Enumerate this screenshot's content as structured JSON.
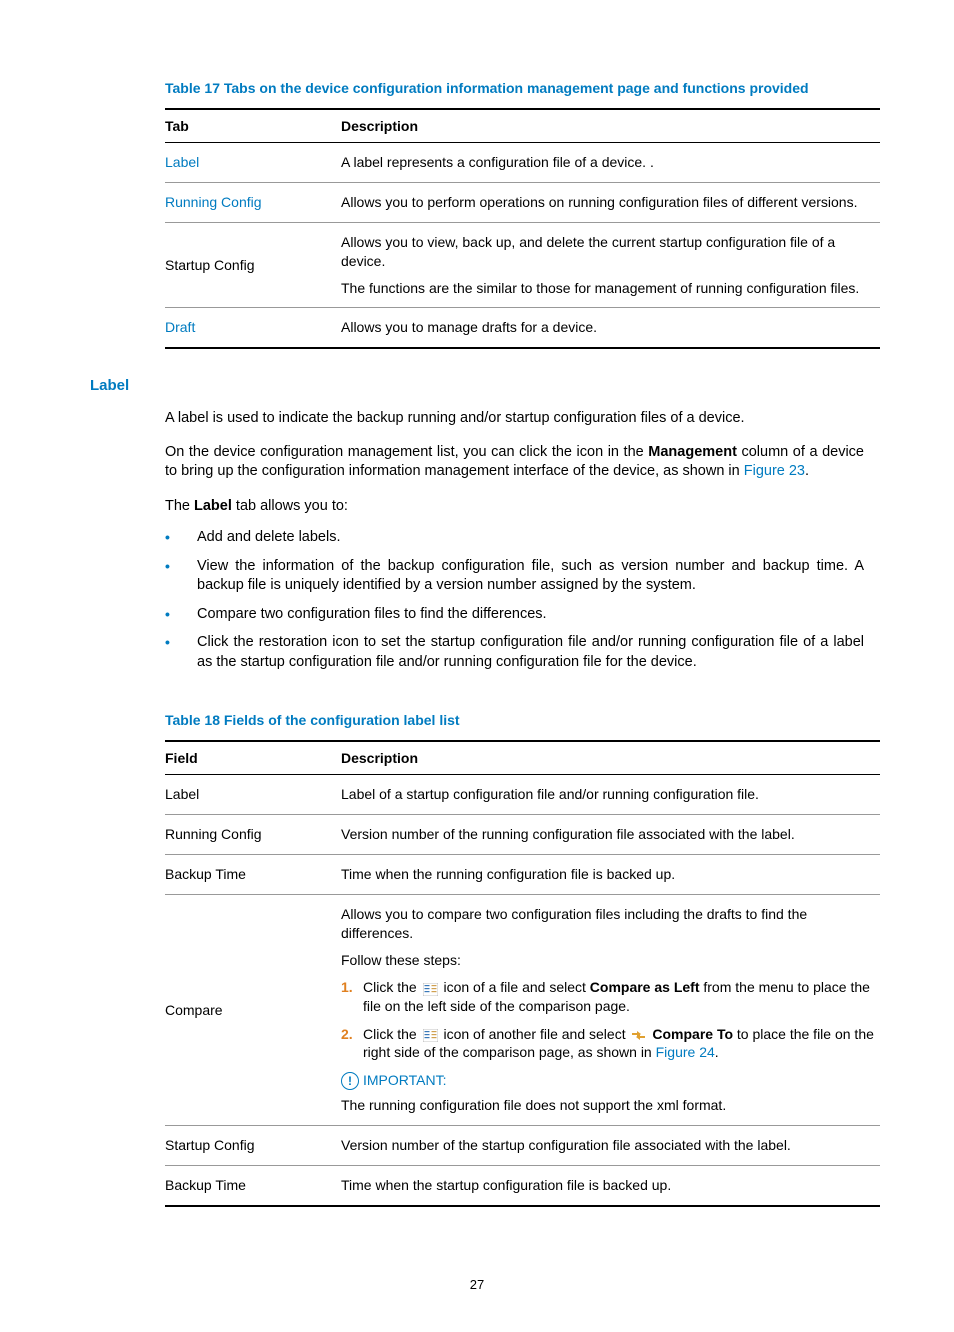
{
  "table17": {
    "caption": "Table 17 Tabs on the device configuration information management page and functions provided",
    "headers": {
      "c1": "Tab",
      "c2": "Description"
    },
    "rows": [
      {
        "tab": "Label",
        "link": true,
        "desc": "A label represents a configuration file of a device. ."
      },
      {
        "tab": "Running Config",
        "link": true,
        "desc": "Allows you to perform operations on running configuration files of different versions."
      },
      {
        "tab": "Startup Config",
        "link": false,
        "desc_a": "Allows you to view, back up, and delete the current startup configuration file of a device.",
        "desc_b": "The functions are the similar to those for management of running configuration files."
      },
      {
        "tab": "Draft",
        "link": true,
        "desc": "Allows you to manage drafts for a device."
      }
    ]
  },
  "label_section": {
    "heading": "Label",
    "p1": "A label is used to indicate the backup running and/or startup configuration files of a device.",
    "p2_a": "On the device configuration management list, you can click the icon in the ",
    "p2_b": "Management",
    "p2_c": " column of a device to bring up the configuration information management interface of the device, as shown in ",
    "p2_link": "Figure 23",
    "p2_d": ".",
    "p3_a": "The ",
    "p3_b": "Label",
    "p3_c": " tab allows you to:",
    "bullets": [
      "Add and delete labels.",
      "View the information of the backup configuration file, such as version number and backup time. A backup file is uniquely identified by a version number assigned by the system.",
      "Compare two configuration files to find the differences.",
      "Click the restoration icon to set the startup configuration file and/or running configuration file of a label as the startup configuration file and/or running configuration file for the device."
    ]
  },
  "table18": {
    "caption": "Table 18 Fields of the configuration label list",
    "headers": {
      "c1": "Field",
      "c2": "Description"
    },
    "rows": {
      "r1": {
        "field": "Label",
        "desc": "Label of a startup configuration file and/or running configuration file."
      },
      "r2": {
        "field": "Running Config",
        "desc": "Version number of the running configuration file associated with the label."
      },
      "r3": {
        "field": "Backup Time",
        "desc": "Time when the running configuration file is backed up."
      },
      "r4": {
        "field": "Compare",
        "p1": "Allows you to compare two configuration files including the drafts to find the differences.",
        "p2": "Follow these steps:",
        "s1a": "Click the ",
        "s1b": " icon of a file and select ",
        "s1c": "Compare as Left",
        "s1d": " from the menu to place the file on the left side of the comparison page.",
        "s2a": "Click the ",
        "s2b": " icon of another file and select ",
        "s2c": "Compare To",
        "s2d": " to place the file on the right side of the comparison page, as shown in ",
        "s2link": "Figure 24",
        "s2e": ".",
        "imp_label": "IMPORTANT:",
        "imp_text": "The running configuration file does not support the xml format."
      },
      "r5": {
        "field": "Startup Config",
        "desc": "Version number of the startup configuration file associated with the label."
      },
      "r6": {
        "field": "Backup Time",
        "desc": "Time when the startup configuration file is backed up."
      }
    }
  },
  "pagenum": "27"
}
